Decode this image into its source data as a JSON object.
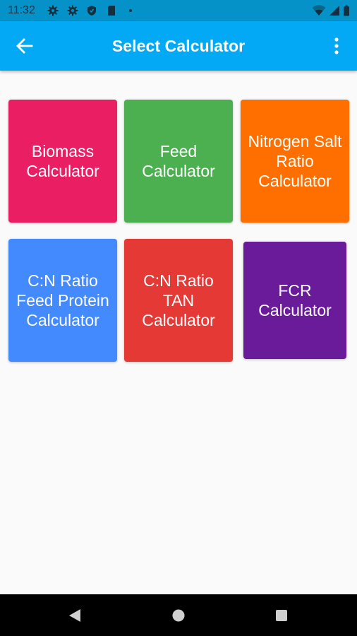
{
  "status_bar": {
    "time": "11:32",
    "icons": [
      "gear-icon",
      "gear-icon",
      "shield-icon",
      "sim-card-icon",
      "notification-dot-icon",
      "wifi-icon",
      "cell-signal-icon",
      "battery-icon"
    ]
  },
  "app_bar": {
    "title": "Select Calculator",
    "back_icon": "arrow-left-icon",
    "menu_icon": "more-vert-icon",
    "color": "#03a9f4"
  },
  "tiles": [
    {
      "label": "Biomass\nCalculator",
      "color": "#e91e63"
    },
    {
      "label": "Feed\nCalculator",
      "color": "#4caf50"
    },
    {
      "label": "Nitrogen Salt\nRatio\nCalculator",
      "color": "#ff6f00"
    },
    {
      "label": "C:N Ratio\nFeed Protein\nCalculator",
      "color": "#448aff"
    },
    {
      "label": "C:N Ratio\nTAN\nCalculator",
      "color": "#e53935"
    },
    {
      "label": "FCR\nCalculator",
      "color": "#6a1b9a"
    }
  ],
  "nav_bar": {
    "icons": [
      "back-triangle-icon",
      "home-circle-icon",
      "recents-square-icon"
    ]
  }
}
